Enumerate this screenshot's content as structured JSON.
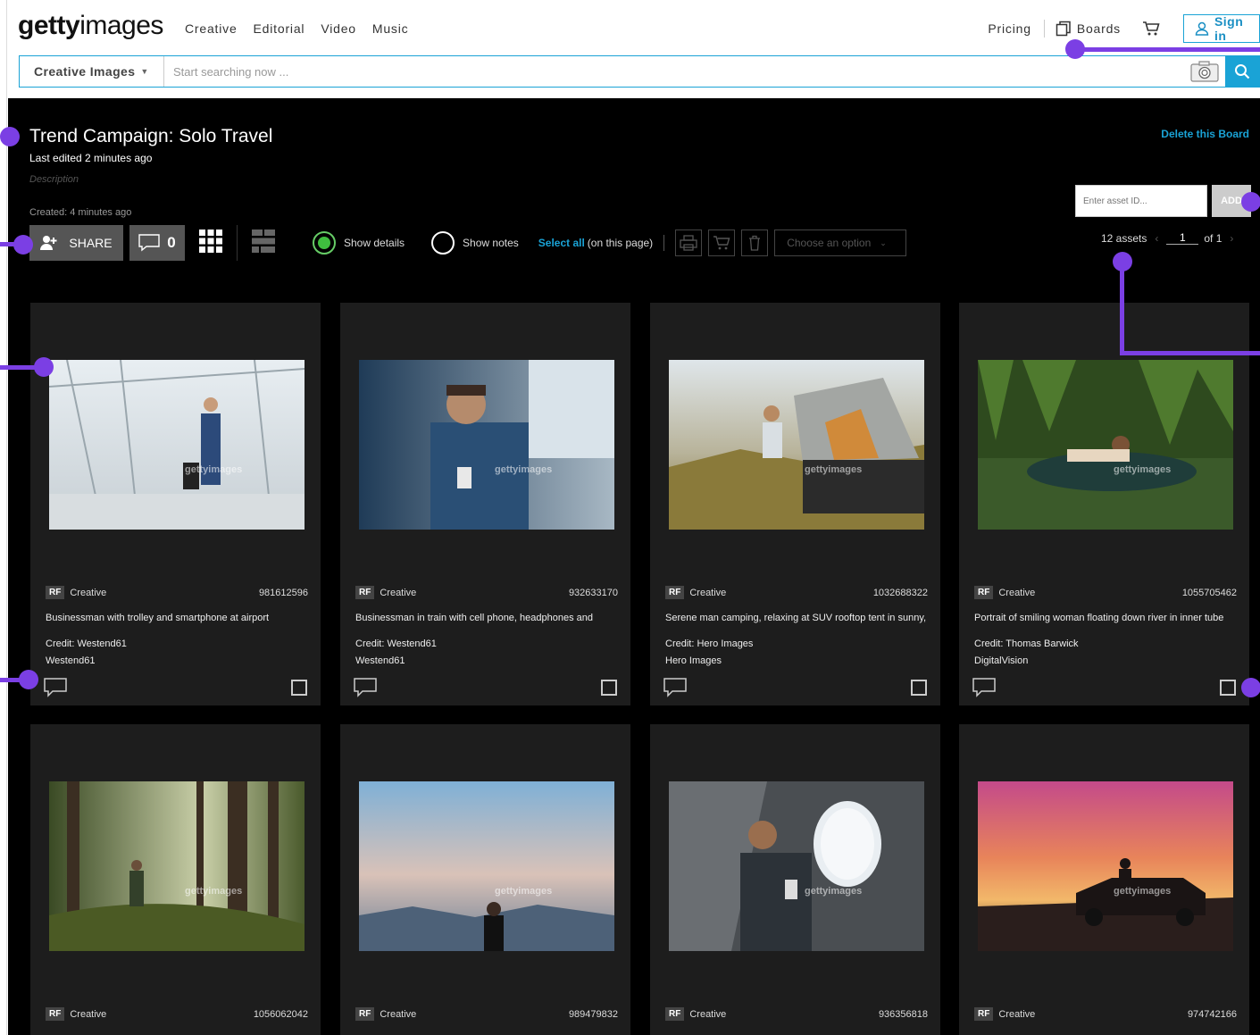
{
  "header": {
    "logo_bold": "getty",
    "logo_light": "images",
    "nav": [
      "Creative",
      "Editorial",
      "Video",
      "Music"
    ],
    "pricing": "Pricing",
    "boards": "Boards",
    "sign_in": "Sign in"
  },
  "search": {
    "type_label": "Creative Images",
    "placeholder": "Start searching now ..."
  },
  "board": {
    "title": "Trend Campaign: Solo Travel",
    "last_edited": "Last edited 2 minutes ago",
    "description_placeholder": "Description",
    "created": "Created: 4 minutes ago",
    "delete_label": "Delete this Board",
    "asset_input_placeholder": "Enter asset ID...",
    "add_label": "ADD",
    "share_label": "SHARE",
    "comment_count": "0",
    "show_details_label": "Show details",
    "show_notes_label": "Show notes",
    "select_all_label": "Select all",
    "select_all_tail": "(on this page)",
    "choose_option": "Choose an option",
    "assets_count": "12 assets",
    "page_current": "1",
    "page_of": "of 1"
  },
  "cards": [
    {
      "license": "RF",
      "type": "Creative",
      "id": "981612596",
      "caption": "Businessman with trolley and smartphone at airport",
      "credit": "Credit: Westend61",
      "collection": "Westend61"
    },
    {
      "license": "RF",
      "type": "Creative",
      "id": "932633170",
      "caption": "Businessman in train with cell phone, headphones and",
      "credit": "Credit: Westend61",
      "collection": "Westend61"
    },
    {
      "license": "RF",
      "type": "Creative",
      "id": "1032688322",
      "caption": "Serene man camping, relaxing at SUV rooftop tent in sunny,",
      "credit": "Credit: Hero Images",
      "collection": "Hero Images"
    },
    {
      "license": "RF",
      "type": "Creative",
      "id": "1055705462",
      "caption": "Portrait of smiling woman floating down river in inner tube",
      "credit": "Credit: Thomas Barwick",
      "collection": "DigitalVision"
    },
    {
      "license": "RF",
      "type": "Creative",
      "id": "1056062042"
    },
    {
      "license": "RF",
      "type": "Creative",
      "id": "989479832"
    },
    {
      "license": "RF",
      "type": "Creative",
      "id": "936356818"
    },
    {
      "license": "RF",
      "type": "Creative",
      "id": "974742166"
    }
  ],
  "watermark": "gettyimages",
  "colors": {
    "accent": "#1aa3d6",
    "annotation": "#7b3fe4",
    "show_details_on": "#3fbf3f"
  }
}
